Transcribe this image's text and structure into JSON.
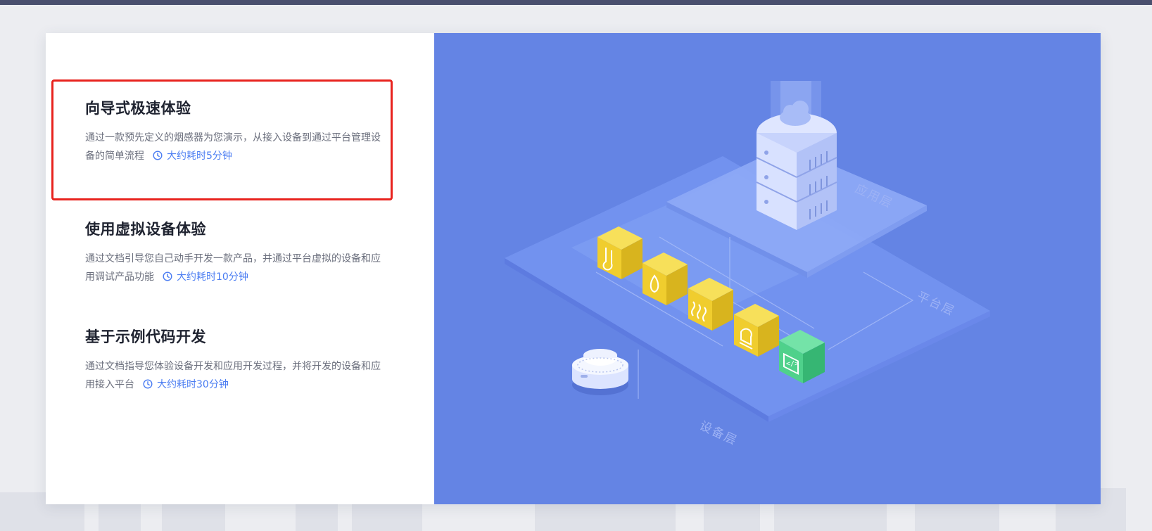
{
  "options": [
    {
      "title": "向导式极速体验",
      "desc": "通过一款预先定义的烟感器为您演示，从接入设备到通过平台管理设备的简单流程",
      "time": "大约耗时5分钟"
    },
    {
      "title": "使用虚拟设备体验",
      "desc": "通过文档引导您自己动手开发一款产品，并通过平台虚拟的设备和应用调试产品功能",
      "time": "大约耗时10分钟"
    },
    {
      "title": "基于示例代码开发",
      "desc": "通过文档指导您体验设备开发和应用开发过程，并将开发的设备和应用接入平台",
      "time": "大约耗时30分钟"
    }
  ],
  "illustration": {
    "layers": {
      "app": "应用层",
      "platform": "平台层",
      "device": "设备层"
    }
  },
  "colors": {
    "highlight": "#e8231e",
    "accent": "#4a7cf2",
    "illustration_bg": "#6484e4",
    "cube_yellow": "#f3d43a",
    "cube_green": "#4fd18b"
  },
  "icons": [
    "clock-icon",
    "server-icon",
    "cloud-icon",
    "thermometer-icon",
    "water-drop-icon",
    "steam-icon",
    "alarm-icon",
    "code-icon",
    "smoke-detector-icon"
  ]
}
